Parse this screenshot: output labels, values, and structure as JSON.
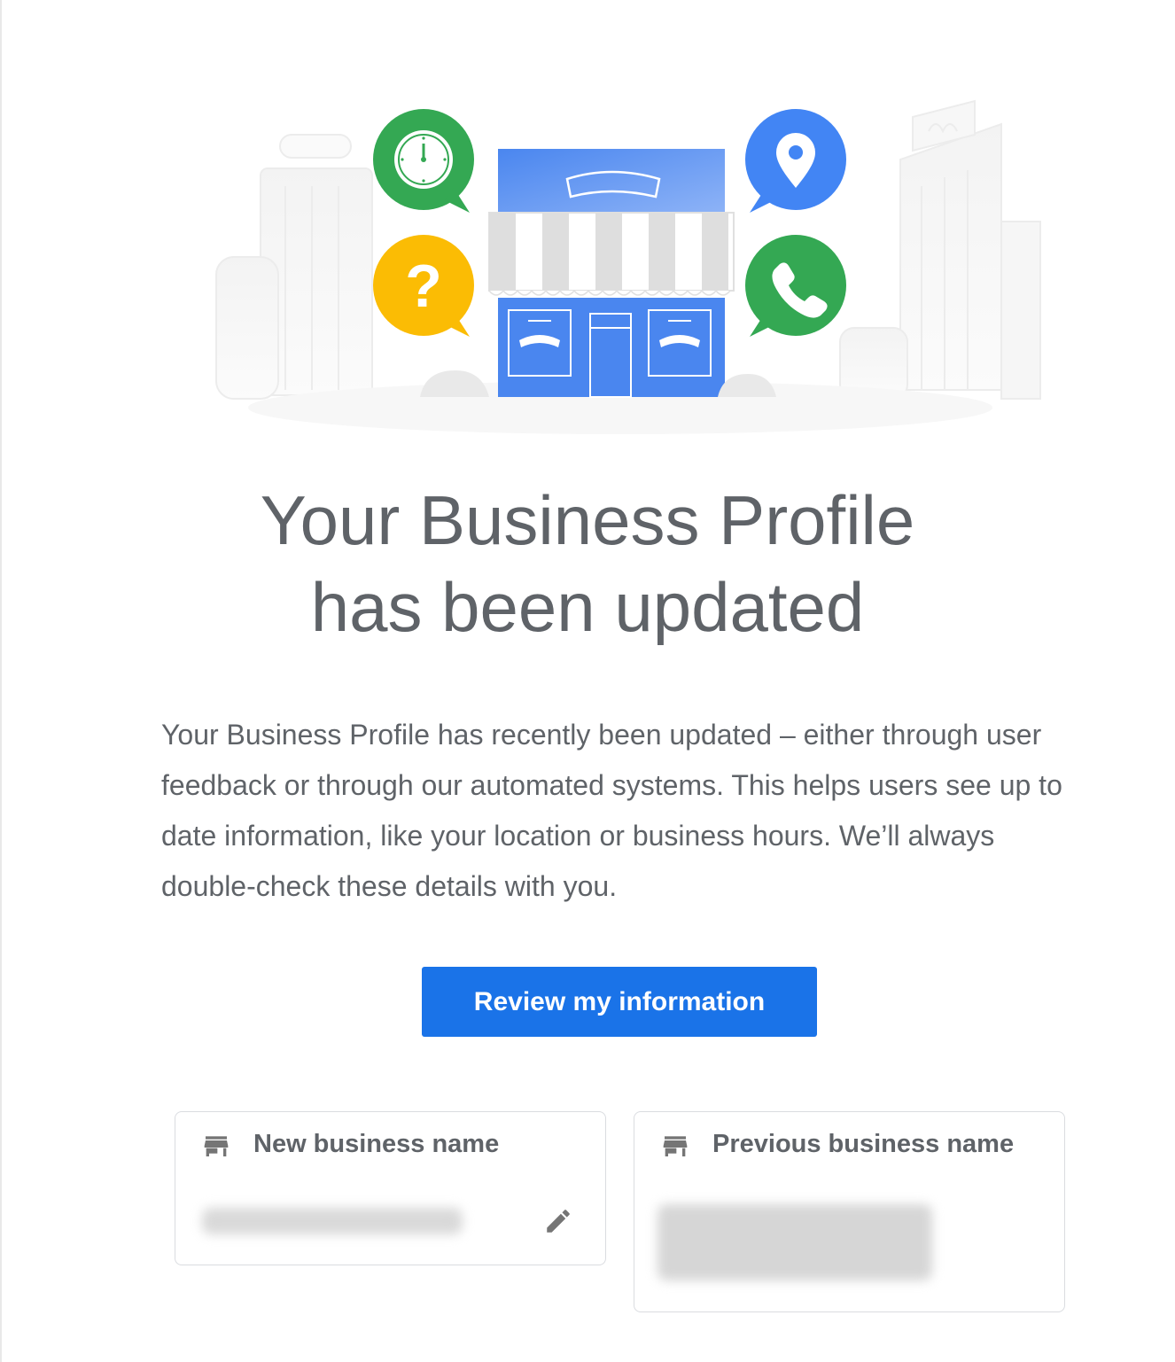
{
  "header": {
    "title_line1": "Your Business Profile",
    "title_line2": "has been updated"
  },
  "message": {
    "body": "Your Business Profile has recently been updated – either through user feedback or through our automated systems. This helps users see up to date information, like your location or business hours. We’ll always double-check these details with you."
  },
  "actions": {
    "review_label": "Review my information"
  },
  "cards": {
    "new_name": {
      "label": "New business name",
      "icon": "storefront-icon",
      "value_obscured": true,
      "action_icon": "pencil-edit-icon"
    },
    "previous_name": {
      "label": "Previous business name",
      "icon": "storefront-icon",
      "value_obscured": true
    }
  },
  "hero": {
    "icons": [
      "clock-icon",
      "question-icon",
      "location-pin-icon",
      "phone-icon",
      "storefront-illustration"
    ]
  },
  "colors": {
    "primary": "#1a73e8",
    "text": "#5f6368",
    "green": "#34a853",
    "yellow": "#fbbc04",
    "blue": "#4285f4",
    "border": "#dadce0"
  }
}
